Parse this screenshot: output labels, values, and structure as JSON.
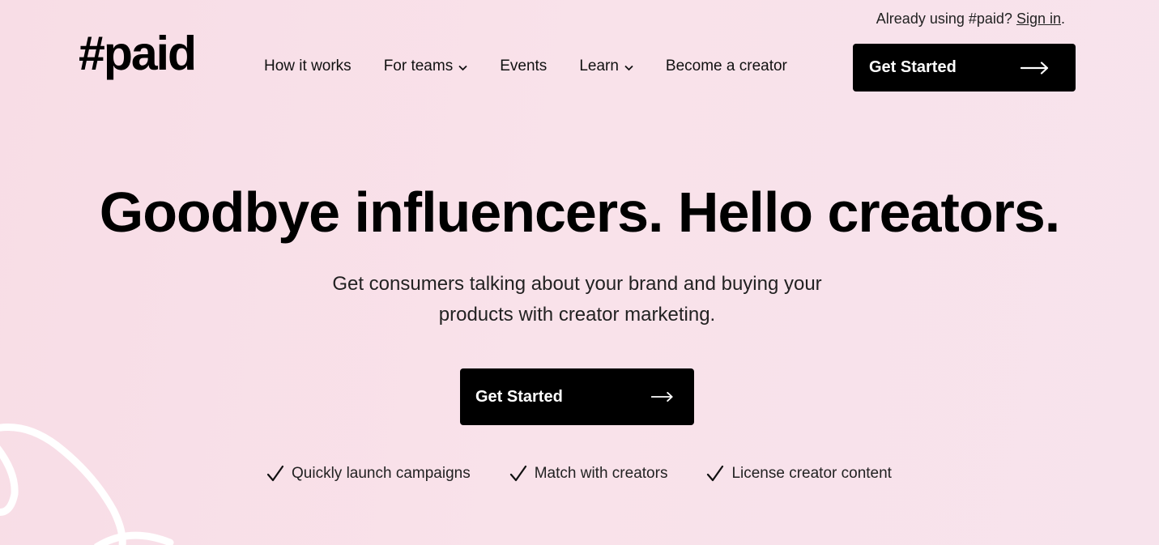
{
  "colors": {
    "background_start": "#f8dde6",
    "background_end": "#f7e3ec",
    "button_bg": "#000000",
    "button_text": "#ffffff",
    "text": "#111111"
  },
  "topbar": {
    "prefix": "Already using #paid?",
    "signin_label": "Sign in",
    "suffix": "."
  },
  "header": {
    "logo": "#paid",
    "nav": [
      {
        "label": "How it works",
        "dropdown": false
      },
      {
        "label": "For teams",
        "dropdown": true
      },
      {
        "label": "Events",
        "dropdown": false
      },
      {
        "label": "Learn",
        "dropdown": true
      },
      {
        "label": "Become a creator",
        "dropdown": false
      }
    ],
    "cta_label": "Get Started",
    "cta_icon": "arrow-right-icon"
  },
  "hero": {
    "title": "Goodbye influencers. Hello creators.",
    "subtitle": "Get consumers talking about your brand and buying your products with creator marketing.",
    "cta_label": "Get Started",
    "cta_icon": "arrow-right-icon",
    "features": [
      {
        "icon": "check-icon",
        "label": "Quickly launch campaigns"
      },
      {
        "icon": "check-icon",
        "label": "Match with creators"
      },
      {
        "icon": "check-icon",
        "label": "License creator content"
      }
    ]
  }
}
